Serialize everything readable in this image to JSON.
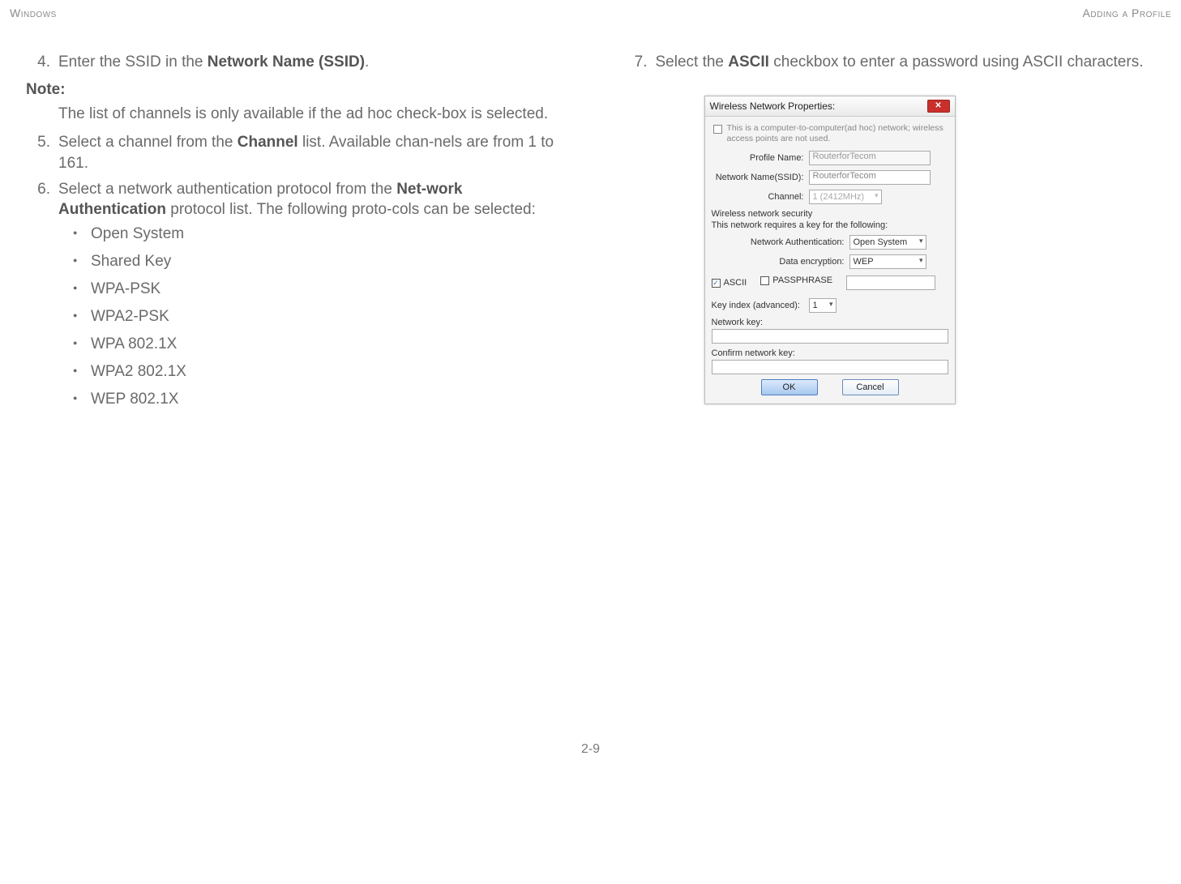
{
  "header": {
    "left": "Windows",
    "right": "Adding a Profile"
  },
  "left": {
    "step4_num": "4.",
    "step4_pre": "Enter the SSID in the ",
    "step4_bold": "Network Name (SSID)",
    "step4_post": ".",
    "note_label": "Note:",
    "note_body": "The list of channels is only available if the ad hoc check-box is selected.",
    "step5_num": "5.",
    "step5_pre": "Select a channel from the ",
    "step5_bold": "Channel",
    "step5_post": " list. Available chan-nels are from 1 to 161.",
    "step6_num": "6.",
    "step6_pre": "Select a network authentication protocol from the ",
    "step6_bold": "Net-work Authentication",
    "step6_post": " protocol list. The following proto-cols can be selected:",
    "bullets": [
      "Open System",
      "Shared Key",
      "WPA-PSK",
      "WPA2-PSK",
      "WPA 802.1X",
      "WPA2 802.1X",
      "WEP 802.1X"
    ]
  },
  "right": {
    "step7_num": "7.",
    "step7_pre": "Select the ",
    "step7_bold": "ASCII",
    "step7_post": " checkbox to enter a password using ASCII characters."
  },
  "dialog": {
    "title": "Wireless Network Properties:",
    "adhoc_text": "This is a computer-to-computer(ad hoc) network; wireless access points are not used.",
    "profile_name_label": "Profile Name:",
    "profile_name_value": "RouterforTecom",
    "ssid_label": "Network Name(SSID):",
    "ssid_value": "RouterforTecom",
    "channel_label": "Channel:",
    "channel_value": "1 (2412MHz)",
    "sec_header": "Wireless network security",
    "sec_sub": "This network requires a key for the following:",
    "auth_label": "Network Authentication:",
    "auth_value": "Open System",
    "enc_label": "Data encryption:",
    "enc_value": "WEP",
    "ascii_label": "ASCII",
    "pass_label": "PASSPHRASE",
    "keyidx_label": "Key index (advanced):",
    "keyidx_value": "1",
    "netkey_label": "Network key:",
    "confirm_label": "Confirm network key:",
    "ok": "OK",
    "cancel": "Cancel"
  },
  "footer": "2-9"
}
